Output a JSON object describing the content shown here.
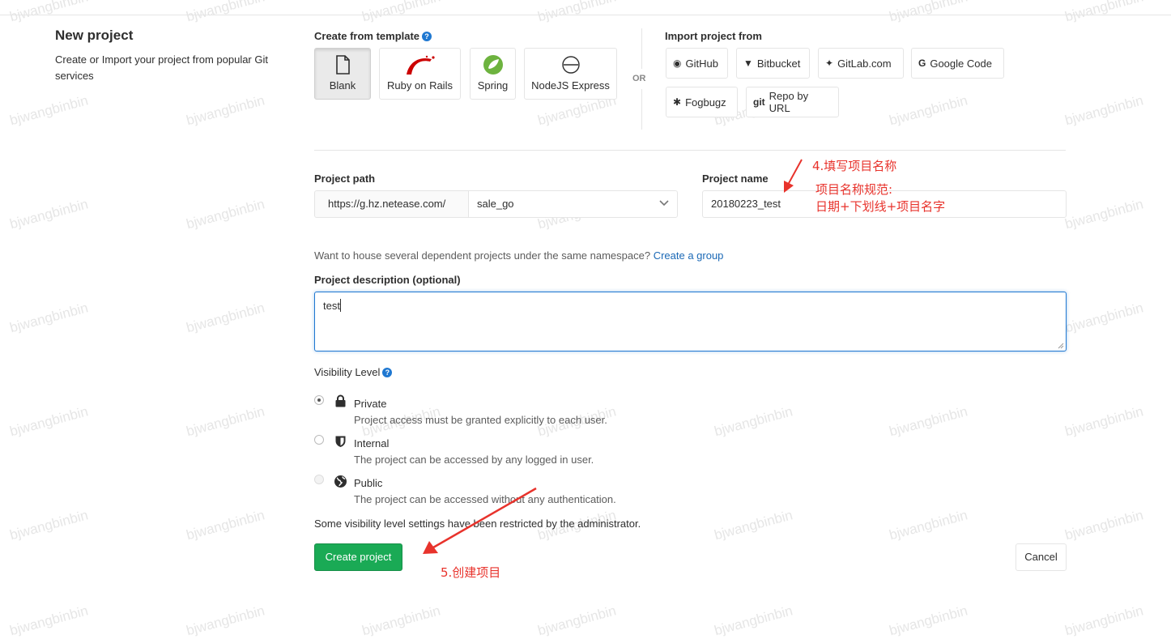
{
  "header": {
    "title": "New project",
    "description": "Create or Import your project from popular Git services"
  },
  "templates": {
    "label": "Create from template",
    "help_icon": "question-circle-icon",
    "items": [
      {
        "label": "Blank",
        "icon": "file-icon",
        "active": true
      },
      {
        "label": "Ruby on Rails",
        "icon": "rails-icon"
      },
      {
        "label": "Spring",
        "icon": "spring-icon"
      },
      {
        "label": "NodeJS Express",
        "icon": "express-icon"
      }
    ]
  },
  "or_label": "OR",
  "import": {
    "label": "Import project from",
    "items": [
      {
        "label": "GitHub",
        "icon": "github-icon"
      },
      {
        "label": "Bitbucket",
        "icon": "bitbucket-icon"
      },
      {
        "label": "GitLab.com",
        "icon": "gitlab-icon"
      },
      {
        "label": "Google Code",
        "icon": "google-icon"
      },
      {
        "label": "Fogbugz",
        "icon": "bug-icon"
      },
      {
        "label": "Repo by URL",
        "icon": "git-icon"
      }
    ]
  },
  "form": {
    "path_label": "Project path",
    "path_prefix": "https://g.hz.netease.com/",
    "namespace": "sale_go",
    "name_label": "Project name",
    "name_value": "20180223_test",
    "group_hint": "Want to house several dependent projects under the same namespace?",
    "group_link": "Create a group",
    "description_label": "Project description (optional)",
    "description_value": "test",
    "visibility_label": "Visibility Level",
    "visibility": [
      {
        "title": "Private",
        "desc": "Project access must be granted explicitly to each user.",
        "icon": "lock-icon",
        "checked": true
      },
      {
        "title": "Internal",
        "desc": "The project can be accessed by any logged in user.",
        "icon": "shield-icon"
      },
      {
        "title": "Public",
        "desc": "The project can be accessed without any authentication.",
        "icon": "globe-icon",
        "disabled": true
      }
    ],
    "restricted_note": "Some visibility level settings have been restricted by the administrator.",
    "create_button": "Create project",
    "cancel_button": "Cancel"
  },
  "annotations": {
    "step4": "4.填写项目名称",
    "rule_title": "项目名称规范:",
    "rule_body": "日期+下划线+项目名字",
    "step5": "5.创建项目",
    "color": "#e8332c"
  },
  "watermark": "bjwangbinbin"
}
